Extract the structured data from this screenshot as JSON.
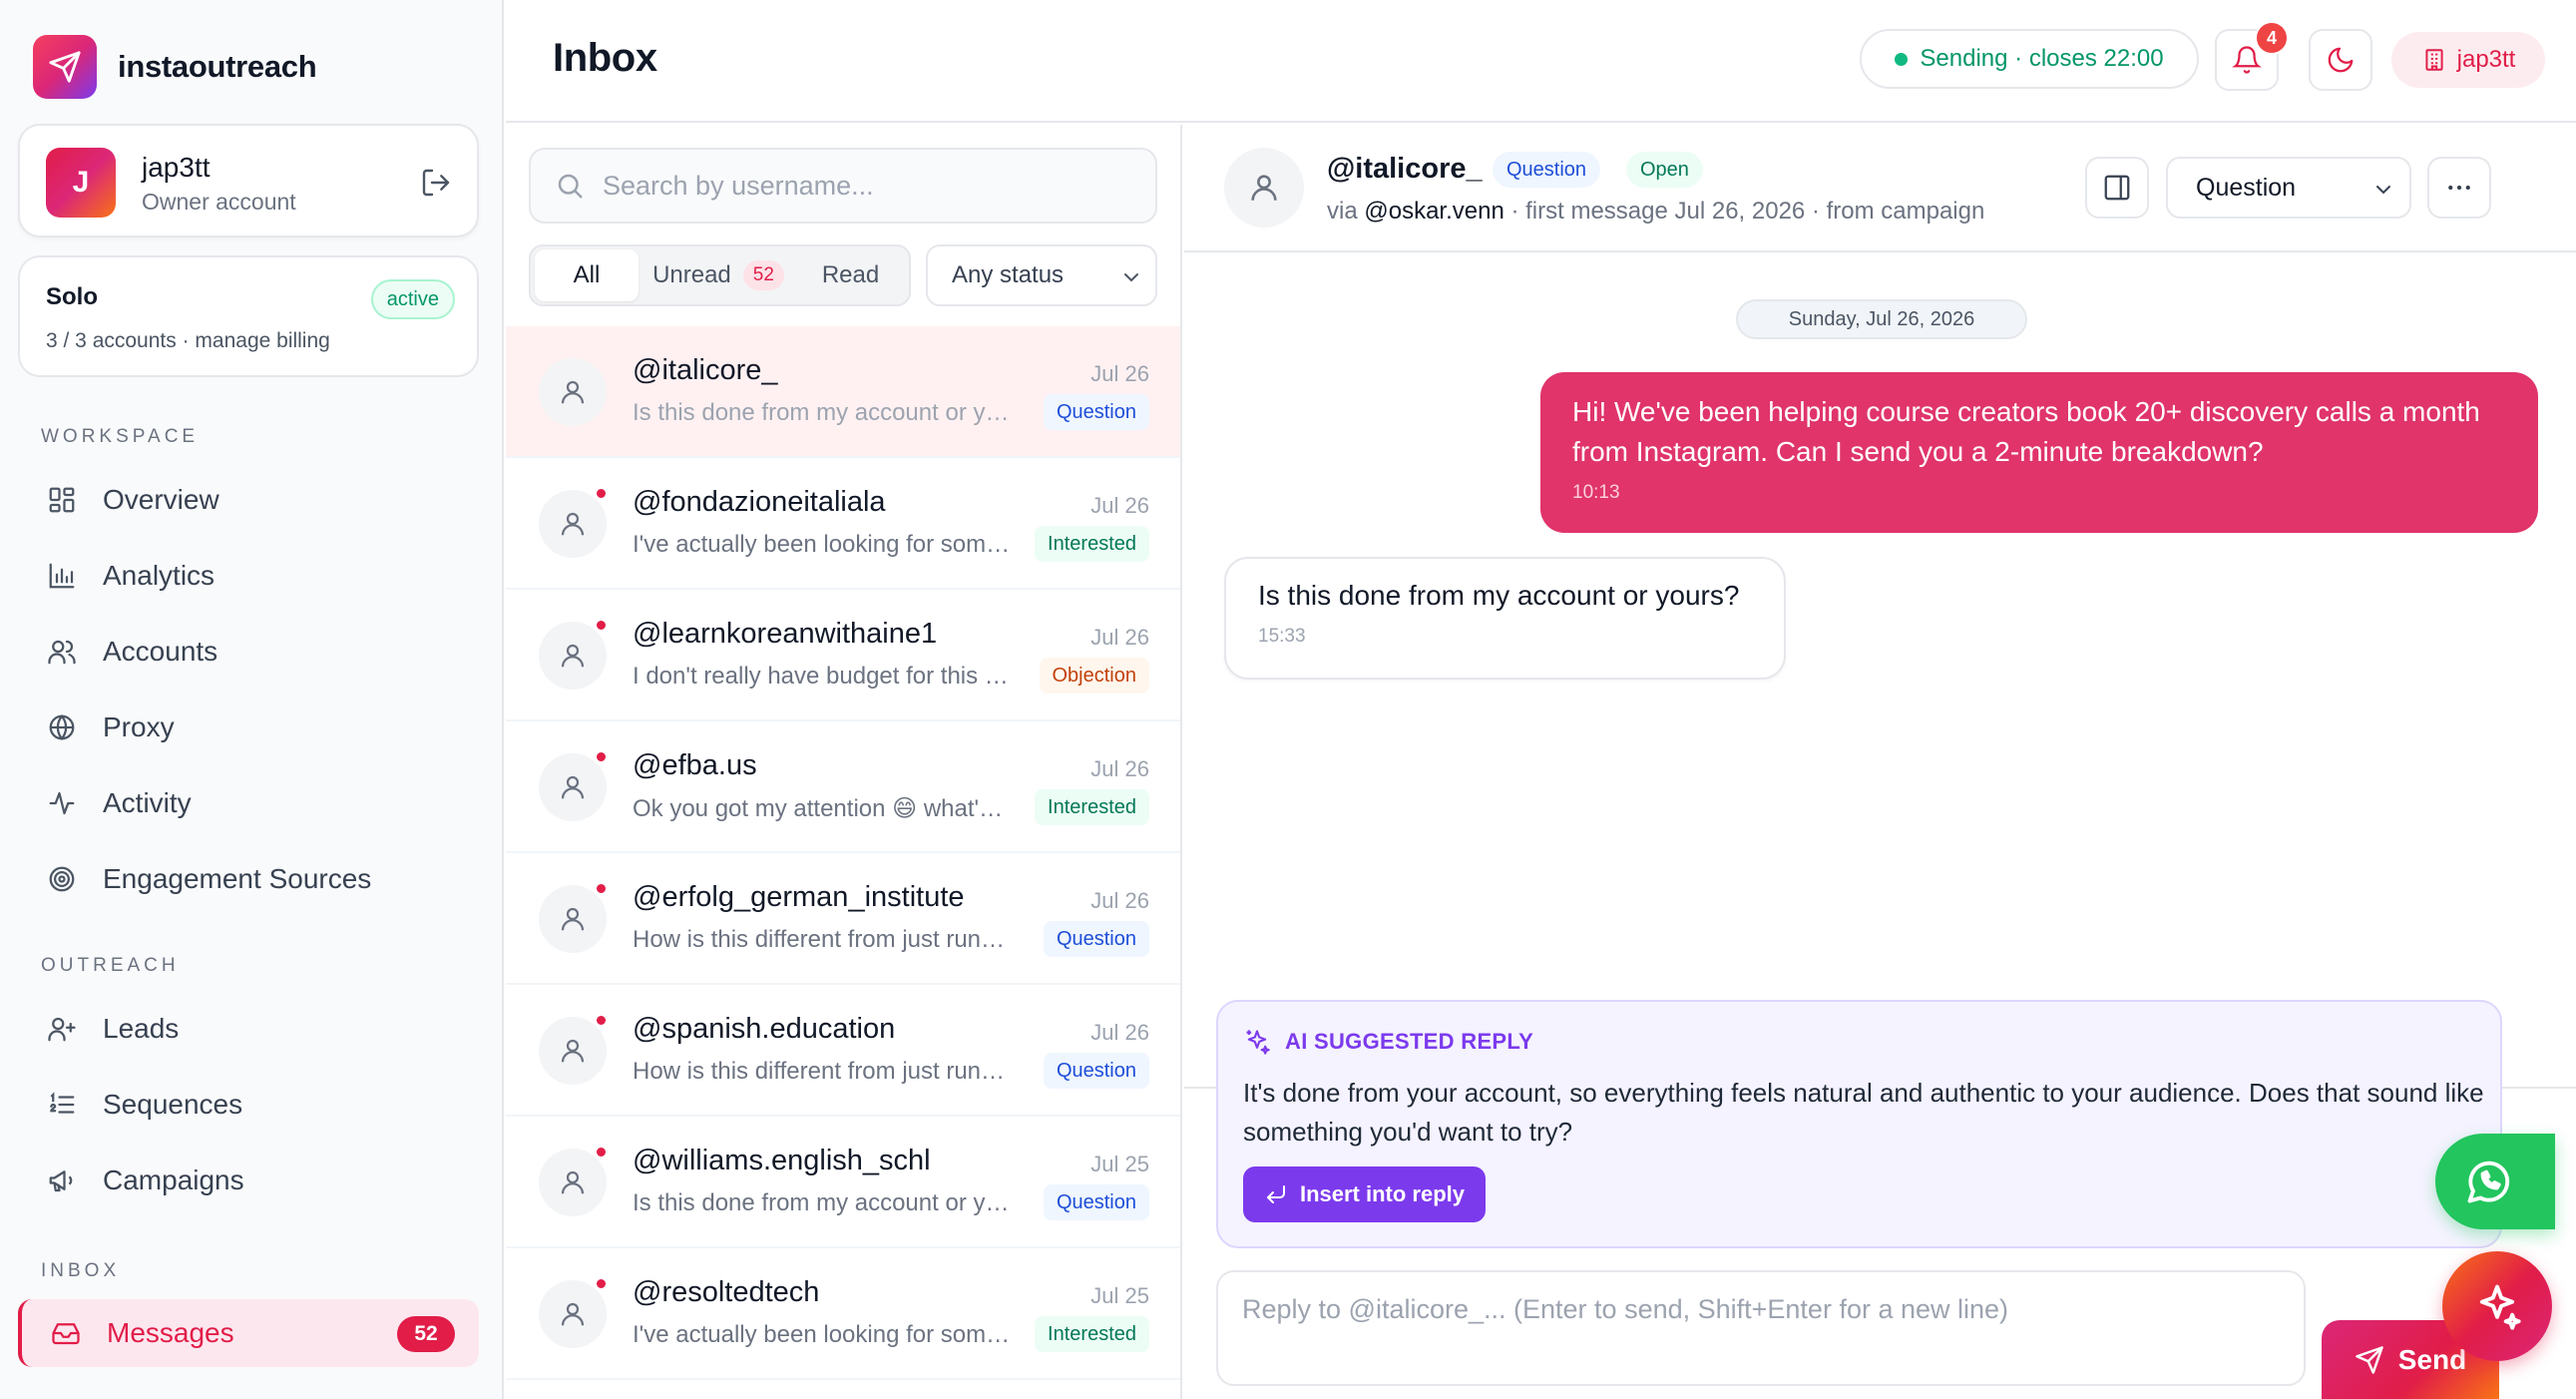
{
  "brand": {
    "name": "instaoutreach",
    "logo_icon": "paper-plane-icon",
    "accent": "#e11d48"
  },
  "account": {
    "initial": "J",
    "name": "jap3tt",
    "role": "Owner account"
  },
  "plan": {
    "name": "Solo",
    "status": "active",
    "meta": "3 / 3 accounts · manage billing"
  },
  "sidebar": {
    "sections": [
      {
        "label": "WORKSPACE",
        "items": [
          {
            "label": "Overview",
            "icon": "grid-icon"
          },
          {
            "label": "Analytics",
            "icon": "bar-chart-icon"
          },
          {
            "label": "Accounts",
            "icon": "users-icon"
          },
          {
            "label": "Proxy",
            "icon": "globe-icon"
          },
          {
            "label": "Activity",
            "icon": "activity-icon"
          },
          {
            "label": "Engagement Sources",
            "icon": "target-icon"
          }
        ]
      },
      {
        "label": "OUTREACH",
        "items": [
          {
            "label": "Leads",
            "icon": "user-plus-icon"
          },
          {
            "label": "Sequences",
            "icon": "list-ordered-icon"
          },
          {
            "label": "Campaigns",
            "icon": "megaphone-icon"
          }
        ]
      },
      {
        "label": "INBOX",
        "items": [
          {
            "label": "Messages",
            "icon": "inbox-icon",
            "count": "52",
            "active": true
          }
        ]
      }
    ]
  },
  "topbar": {
    "title": "Inbox",
    "sending_status": "Sending · closes 22:00",
    "notifications": "4",
    "user": "jap3tt"
  },
  "list": {
    "search_placeholder": "Search by username...",
    "tabs": [
      {
        "label": "All",
        "active": true
      },
      {
        "label": "Unread",
        "count": "52"
      },
      {
        "label": "Read"
      }
    ],
    "status_filter": "Any status",
    "conversations": [
      {
        "name": "@italicore_",
        "date": "Jul 26",
        "preview": "Is this done from my account or yours?",
        "tag": "Question",
        "unread": false,
        "selected": true
      },
      {
        "name": "@fondazioneitaliala",
        "date": "Jul 26",
        "preview": "I've actually been looking for something like this",
        "tag": "Interested",
        "unread": true
      },
      {
        "name": "@learnkoreanwithaine1",
        "date": "Jul 26",
        "preview": "I don't really have budget for this right now",
        "tag": "Objection",
        "unread": true
      },
      {
        "name": "@efba.us",
        "date": "Jul 26",
        "preview": "Ok you got my attention 😄 what's the catch",
        "tag": "Interested",
        "unread": true
      },
      {
        "name": "@erfolg_german_institute",
        "date": "Jul 26",
        "preview": "How is this different from just running ads?",
        "tag": "Question",
        "unread": true
      },
      {
        "name": "@spanish.education",
        "date": "Jul 26",
        "preview": "How is this different from just running ads?",
        "tag": "Question",
        "unread": true
      },
      {
        "name": "@williams.english_schl",
        "date": "Jul 25",
        "preview": "Is this done from my account or yours?",
        "tag": "Question",
        "unread": true
      },
      {
        "name": "@resoltedtech",
        "date": "Jul 25",
        "preview": "I've actually been looking for something like this",
        "tag": "Interested",
        "unread": true
      }
    ]
  },
  "thread": {
    "name": "@italicore_",
    "tag": "Question",
    "state": "Open",
    "via_prefix": "via ",
    "via_account": "@oskar.venn",
    "meta_suffix": " · first message Jul 26, 2026 · from campaign",
    "category_select": "Question",
    "date_chip": "Sunday, Jul 26, 2026",
    "messages": [
      {
        "direction": "out",
        "text": "Hi! We've been helping course creators book 20+ discovery calls a month from Instagram. Can I send you a 2-minute breakdown?",
        "time": "10:13"
      },
      {
        "direction": "in",
        "text": "Is this done from my account or yours?",
        "time": "15:33"
      }
    ],
    "ai": {
      "heading": "AI SUGGESTED REPLY",
      "text": "It's done from your account, so everything feels natural and authentic to your audience. Does that sound like something you'd want to try?",
      "insert_label": "Insert into reply"
    },
    "reply_placeholder": "Reply to @italicore_... (Enter to send, Shift+Enter for a new line)",
    "send_label": "Send"
  }
}
